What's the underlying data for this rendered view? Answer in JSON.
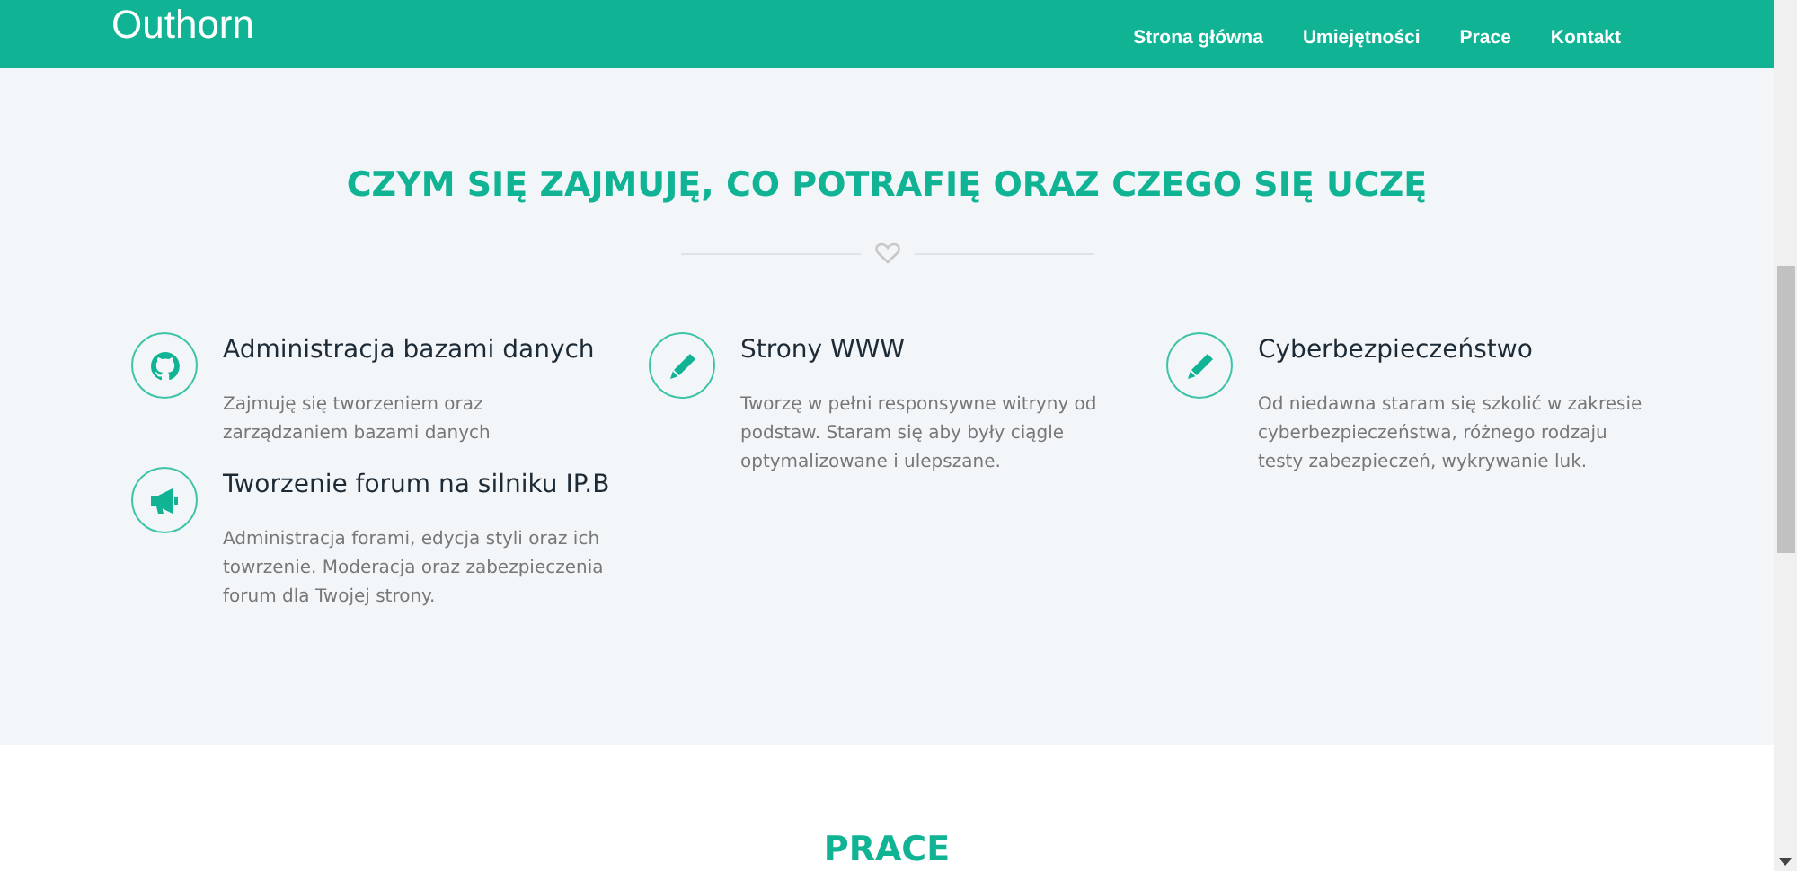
{
  "navbar": {
    "brand": "Outhorn",
    "links": [
      {
        "label": "Strona główna"
      },
      {
        "label": "Umiejętności"
      },
      {
        "label": "Prace"
      },
      {
        "label": "Kontakt"
      }
    ]
  },
  "skills": {
    "heading": "CZYM SIĘ ZAJMUJĘ, CO POTRAFIĘ ORAZ CZEGO SIĘ UCZĘ",
    "items": [
      {
        "title": "Administracja bazami danych",
        "description": "Zajmuję się tworzeniem oraz zarządzaniem bazami danych"
      },
      {
        "title": "Strony WWW",
        "description": "Tworzę w pełni responsywne witryny od podstaw. Staram się aby były ciągle optymalizowane i ulepszane."
      },
      {
        "title": "Cyberbezpieczeństwo",
        "description": "Od niedawna staram się szkolić w zakresie cyberbezpieczeństwa, różnego rodzaju testy zabezpieczeń, wykrywanie luk."
      },
      {
        "title": "Tworzenie forum na silniku IP.B",
        "description": "Administracja forami, edycja styli oraz ich towrzenie. Moderacja oraz zabezpieczenia forum dla Twojej strony."
      }
    ]
  },
  "works": {
    "heading": "PRACE"
  }
}
